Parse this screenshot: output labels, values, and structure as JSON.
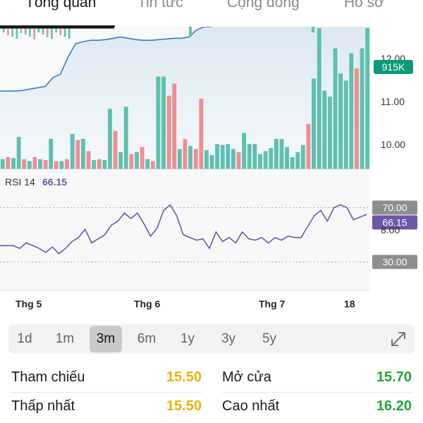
{
  "tabs": [
    {
      "label": "Tổng quan",
      "active": true
    },
    {
      "label": "Tin tức",
      "active": false
    },
    {
      "label": "Cộng đồng",
      "active": false
    },
    {
      "label": "Hồ sơ",
      "active": false
    }
  ],
  "chart_data": {
    "type": "line",
    "price_ticks": [
      "12.00",
      "11.00",
      "10.00",
      "8.00"
    ],
    "volume_badge": "915K",
    "rsi": {
      "label": "RSI 14",
      "value": "66.15",
      "upper_label": "70.00",
      "lower_label": "30.00",
      "upper": 70,
      "lower": 30,
      "ylim": [
        10,
        90
      ],
      "values": [
        42,
        42,
        42,
        40,
        44,
        42,
        40,
        37,
        41,
        36,
        40,
        45,
        48,
        54,
        44,
        47,
        50,
        57,
        60,
        66,
        62,
        66,
        58,
        49,
        55,
        68,
        72,
        64,
        50,
        48,
        46,
        47,
        40,
        52,
        45,
        48,
        44,
        52,
        47,
        46,
        48,
        44,
        48,
        46,
        49,
        48,
        48,
        56,
        64,
        68,
        60,
        70,
        72,
        70,
        61,
        63,
        65
      ]
    },
    "volume": {
      "values": [
        10,
        12,
        11,
        32,
        10,
        8,
        12,
        10,
        9,
        30,
        8,
        8,
        10,
        35,
        29,
        30,
        18,
        9,
        10,
        9,
        60,
        38,
        17,
        62,
        15,
        17,
        22,
        10,
        8,
        92,
        92,
        73,
        85,
        20,
        30,
        23,
        20,
        70,
        19,
        14,
        25,
        24,
        25,
        20,
        17,
        36,
        25,
        25,
        15,
        18,
        21,
        30,
        30,
        22,
        12,
        17,
        24,
        45,
        90,
        140,
        78,
        72,
        120,
        95,
        88,
        115,
        100,
        120,
        140
      ],
      "colors": [
        "g",
        "r",
        "g",
        "g",
        "r",
        "g",
        "r",
        "g",
        "r",
        "g",
        "r",
        "g",
        "r",
        "g",
        "r",
        "g",
        "r",
        "g",
        "r",
        "g",
        "g",
        "r",
        "g",
        "g",
        "r",
        "g",
        "r",
        "g",
        "r",
        "g",
        "g",
        "r",
        "r",
        "g",
        "r",
        "g",
        "r",
        "r",
        "g",
        "g",
        "g",
        "g",
        "g",
        "g",
        "r",
        "g",
        "g",
        "g",
        "g",
        "g",
        "g",
        "g",
        "g",
        "g",
        "g",
        "g",
        "g",
        "r",
        "g",
        "g",
        "g",
        "g",
        "g",
        "g",
        "g",
        "g",
        "r",
        "g",
        "g"
      ]
    },
    "ma_line": {
      "values": [
        0.05,
        0.05,
        0.05,
        0.06,
        0.08,
        0.1,
        0.12,
        0.25,
        0.3,
        0.55,
        0.75,
        0.78,
        0.8,
        0.8,
        0.81,
        0.83,
        0.85,
        0.83,
        0.81,
        0.8,
        0.8,
        0.81,
        0.82,
        0.83,
        0.83,
        0.85,
        0.95,
        1.0,
        1.0
      ]
    },
    "x_labels": [
      "Thg 5",
      "Thg 6",
      "Thg 7",
      "18"
    ],
    "colors": {
      "up": "#5fbfb0",
      "down": "#ef8e92",
      "rsi": "#7055a8",
      "ma": "#3a7cc0",
      "badge_green": "#0d9a78",
      "badge_gray": "#8e8e8e"
    }
  },
  "periods": [
    {
      "label": "1d",
      "active": false
    },
    {
      "label": "1m",
      "active": false
    },
    {
      "label": "3m",
      "active": true
    },
    {
      "label": "6m",
      "active": false
    },
    {
      "label": "1y",
      "active": false
    },
    {
      "label": "3y",
      "active": false
    },
    {
      "label": "5y",
      "active": false
    }
  ],
  "stats": {
    "reference_label": "Tham chiếu",
    "reference_value": "15.50",
    "open_label": "Mở cửa",
    "open_value": "15.70",
    "low_label": "Thấp nhất",
    "low_value": "15.50",
    "high_label": "Cao nhất",
    "high_value": "16.20",
    "ref_color": "#e7b400",
    "up_color": "#22a63a"
  }
}
